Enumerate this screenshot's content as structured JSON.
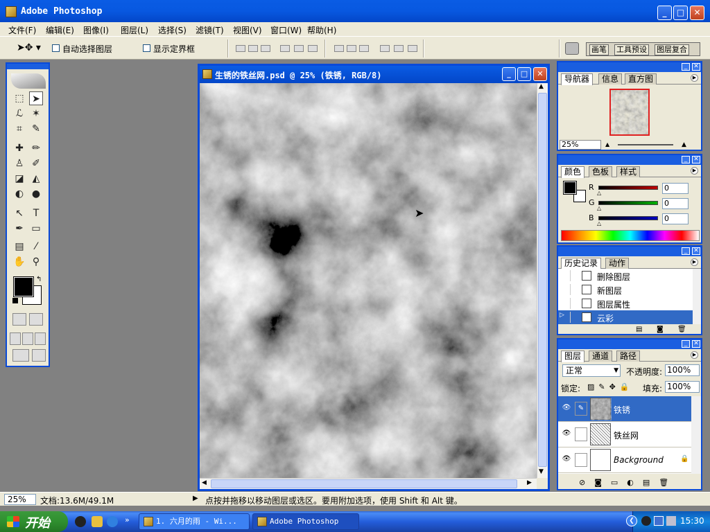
{
  "window": {
    "title": "Adobe Photoshop"
  },
  "menu": [
    "文件(F)",
    "编辑(E)",
    "图像(I)",
    "图层(L)",
    "选择(S)",
    "滤镜(T)",
    "视图(V)",
    "窗口(W)",
    "帮助(H)"
  ],
  "options": {
    "auto_select": "自动选择图层",
    "show_bounds": "显示定界框",
    "wells": [
      "画笔",
      "工具预设",
      "图层复合"
    ]
  },
  "document": {
    "title": "生锈的铁丝网.psd @ 25% (铁锈, RGB/8)"
  },
  "navigator": {
    "tabs": [
      "导航器",
      "信息",
      "直方图"
    ],
    "zoom": "25%"
  },
  "color": {
    "tabs": [
      "颜色",
      "色板",
      "样式"
    ],
    "channels": [
      {
        "label": "R",
        "value": "0",
        "color": "#c00000"
      },
      {
        "label": "G",
        "value": "0",
        "color": "#00b000"
      },
      {
        "label": "B",
        "value": "0",
        "color": "#0000c0"
      }
    ]
  },
  "history": {
    "tabs": [
      "历史记录",
      "动作"
    ],
    "items": [
      "删除图层",
      "新图层",
      "图层属性",
      "云彩"
    ]
  },
  "layers": {
    "tabs": [
      "图层",
      "通道",
      "路径"
    ],
    "blend_mode": "正常",
    "opacity_label": "不透明度:",
    "opacity": "100%",
    "lock_label": "锁定:",
    "fill_label": "填充:",
    "fill": "100%",
    "items": [
      "铁锈",
      "铁丝网",
      "Background"
    ]
  },
  "status": {
    "zoom": "25%",
    "doc": "文档:13.6M/49.1M",
    "hint": "点按并拖移以移动图层或选区。要用附加选项，使用 Shift 和 Alt 键。"
  },
  "taskbar": {
    "start": "开始",
    "tasks": [
      "1. 六月的雨 - Wi...",
      "Adobe Photoshop"
    ],
    "clock": "15:30"
  }
}
